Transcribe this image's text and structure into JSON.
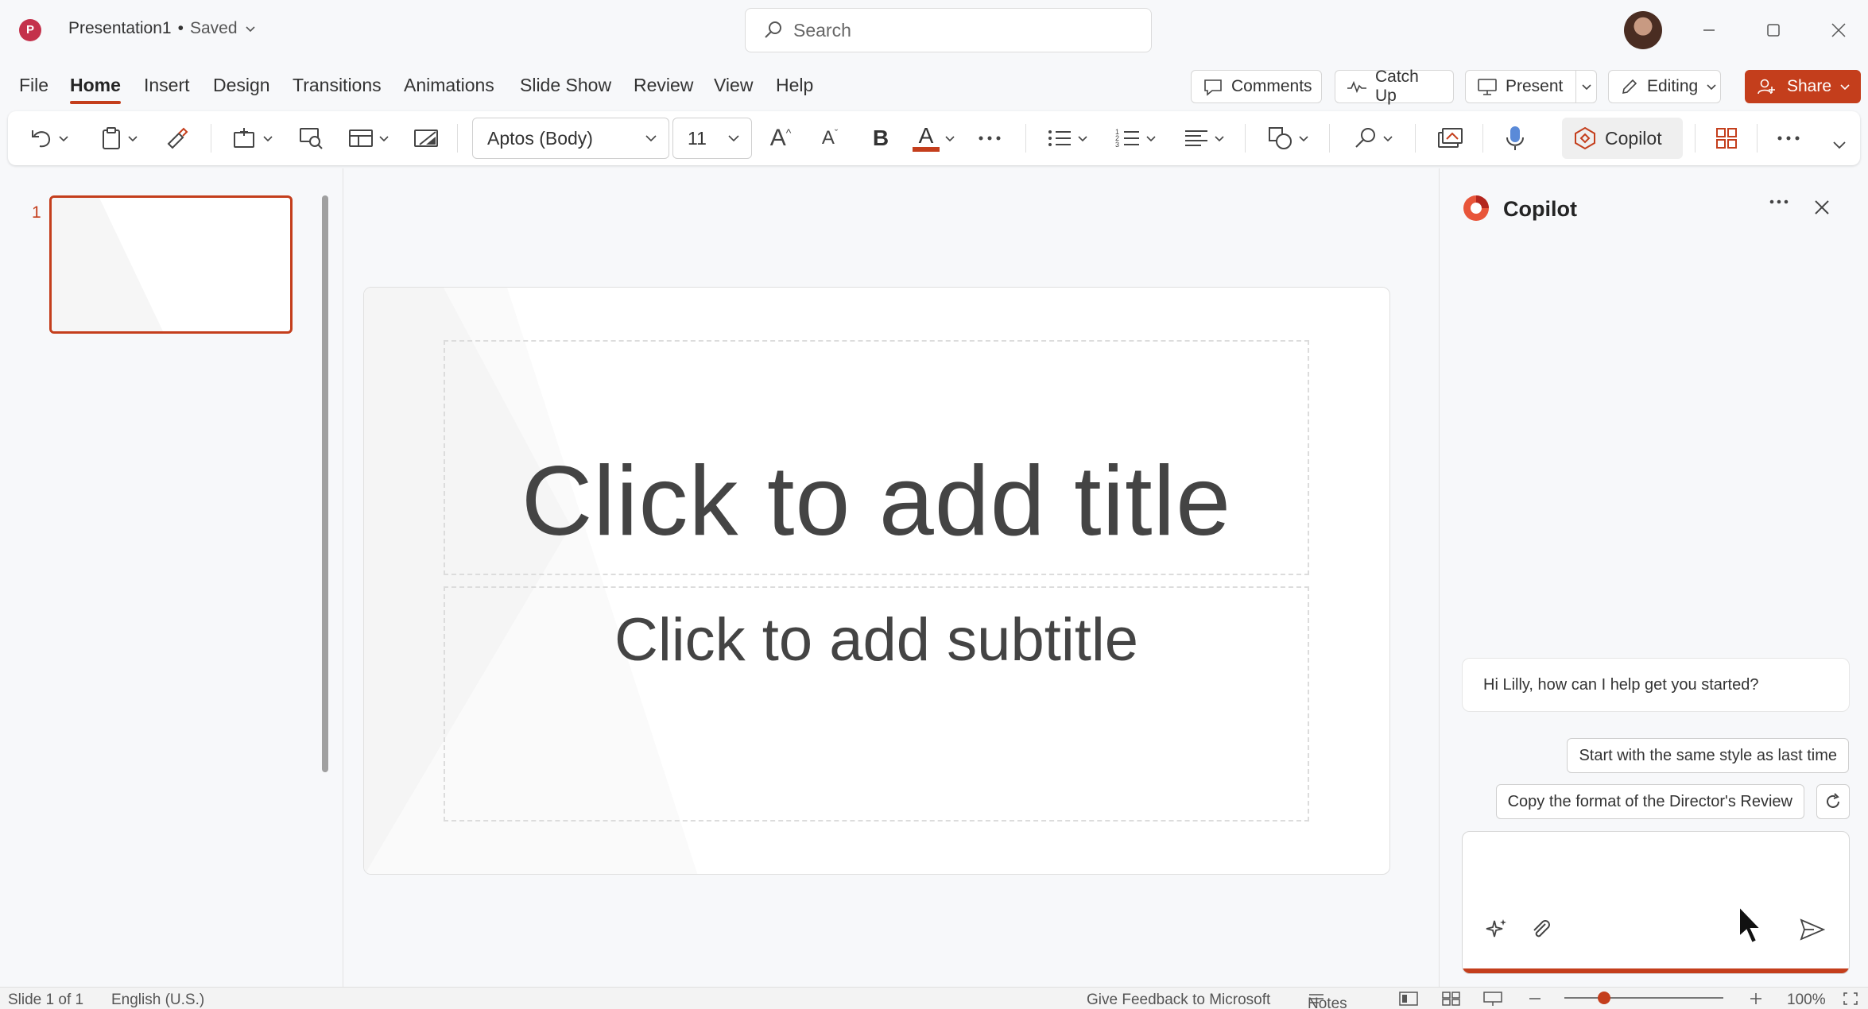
{
  "titlebar": {
    "app_icon": "P",
    "doc_name": "Presentation1",
    "separator": "•",
    "saved_state": "Saved",
    "search_placeholder": "Search"
  },
  "menu": {
    "items": [
      "File",
      "Home",
      "Insert",
      "Design",
      "Transitions",
      "Animations",
      "Slide Show",
      "Review",
      "View",
      "Help"
    ],
    "active": "Home",
    "actions": {
      "comments": "Comments",
      "catch_up": "Catch Up",
      "present": "Present",
      "editing": "Editing",
      "share": "Share"
    }
  },
  "ribbon": {
    "font_name": "Aptos (Body)",
    "font_size": "11",
    "grow_font": "A",
    "shrink_font": "A",
    "bold": "B",
    "font_color": "A",
    "copilot": "Copilot",
    "colors": {
      "accent": "#c43e1c",
      "font_color_bar": "#c43e1c"
    }
  },
  "thumbnails": {
    "slides": [
      {
        "number": "1"
      }
    ]
  },
  "slide": {
    "title_placeholder": "Click to add title",
    "subtitle_placeholder": "Click to add subtitle"
  },
  "copilot": {
    "title": "Copilot",
    "greeting": "Hi Lilly, how can I help get you started?",
    "suggestions": [
      "Start with the same style as last time",
      "Copy the format of the Director's Review"
    ],
    "input_value": ""
  },
  "status": {
    "slide_info": "Slide 1 of 1",
    "language": "English (U.S.)",
    "feedback": "Give Feedback to Microsoft",
    "notes": "Notes",
    "zoom": "100%"
  },
  "icons": {
    "window": [
      "minimize-icon",
      "maximize-icon",
      "close-icon"
    ],
    "ribbon": [
      "undo-icon",
      "paste-icon",
      "format-painter-icon",
      "new-slide-icon",
      "reuse-slides-icon",
      "layout-icon",
      "background-icon",
      "bullets-icon",
      "numbering-icon",
      "align-icon",
      "shapes-icon",
      "find-icon",
      "designer-icon",
      "dictate-icon",
      "addins-icon",
      "more-icon",
      "collapse-ribbon-icon"
    ]
  }
}
